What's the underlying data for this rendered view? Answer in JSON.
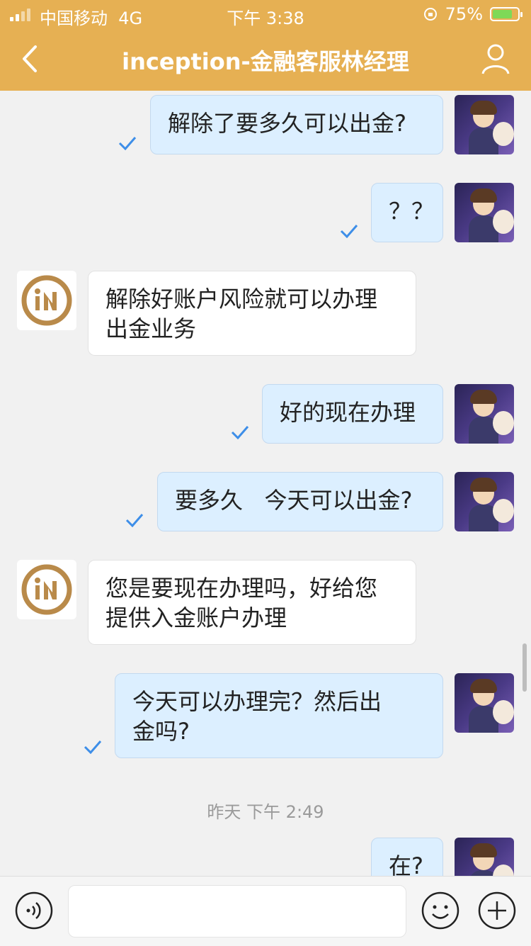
{
  "status_bar": {
    "carrier": "中国移动",
    "network": "4G",
    "time": "下午 3:38",
    "battery": "75%",
    "battery_level": 0.75
  },
  "nav": {
    "title": "inception-金融客服林经理",
    "icons": [
      "chevron-left-icon",
      "user-icon"
    ]
  },
  "messages": [
    {
      "side": "out",
      "text": "解除了要多久可以出金?"
    },
    {
      "side": "out",
      "text": "？？"
    },
    {
      "side": "in",
      "text": "解除好账户风险就可以办理\n出金业务"
    },
    {
      "side": "out",
      "text": "好的现在办理"
    },
    {
      "side": "out",
      "text": "要多久   今天可以出金?"
    },
    {
      "side": "in",
      "text": "您是要现在办理吗，好给您\n提供入金账户办理"
    },
    {
      "side": "out",
      "text": "今天可以办理完？然后出\n金吗?"
    },
    {
      "side": "timestamp",
      "text": "昨天 下午 2:49"
    },
    {
      "side": "out",
      "text": "在?"
    }
  ],
  "input_bar": {
    "placeholder": "",
    "icons": [
      "voice-icon",
      "emoji-icon",
      "plus-icon"
    ]
  },
  "colors": {
    "header": "#e6b053",
    "outgoing_bubble": "#dcefff",
    "incoming_bubble": "#ffffff",
    "check": "#3d8ee8",
    "logo_brand": "#b98a4a"
  }
}
